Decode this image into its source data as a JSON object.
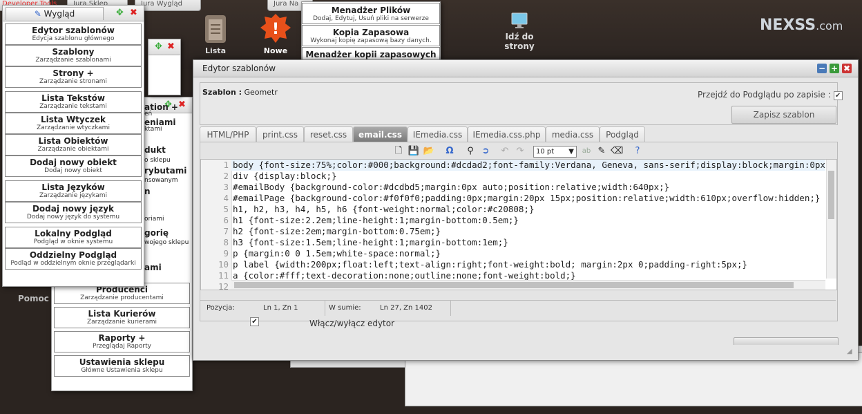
{
  "top": {
    "tabs": [
      "Developer Tools",
      "Jura Sklep",
      "Jura Wygląd",
      "Jura Na"
    ],
    "icons": [
      {
        "label": "Lista",
        "icon": "clipboard-icon"
      },
      {
        "label": "Nowe",
        "icon": "alert-icon"
      },
      {
        "label": "Idź do strony",
        "icon": "monitor-icon"
      }
    ],
    "logo": "NEXSS",
    "logo_suffix": ".com"
  },
  "files_menu": [
    {
      "title": "Menadżer Plików",
      "sub": "Dodaj, Edytuj, Usuń pliki na serwerze"
    },
    {
      "title": "Kopia Zapasowa",
      "sub": "Wykonaj kopię zapasową bazy danych."
    },
    {
      "title": "Menadżer kopii zapasowych",
      "sub": ""
    }
  ],
  "wyglad_panel": {
    "title": "Wygląd",
    "items": [
      {
        "title": "Edytor szablonów",
        "sub": "Edycja szablonu głównego"
      },
      {
        "title": "Szablony",
        "sub": "Zarządzanie szablonami"
      },
      {
        "title": "Strony +",
        "sub": "Zarządzanie stronami"
      },
      {
        "sep": true
      },
      {
        "title": "Lista Tekstów",
        "sub": "Zarządzanie tekstami"
      },
      {
        "title": "Lista Wtyczek",
        "sub": "Zarządzanie wtyczkami"
      },
      {
        "title": "Lista Obiektów",
        "sub": "Zarządzanie obiektami"
      },
      {
        "title": "Dodaj nowy obiekt",
        "sub": "Dodaj nowy obiekt"
      },
      {
        "sep": true
      },
      {
        "title": "Lista Języków",
        "sub": "Zarządzanie językami"
      },
      {
        "title": "Dodaj nowy język",
        "sub": "Dodaj nowy język do systemu"
      },
      {
        "sep": true
      },
      {
        "title": "Lokalny Podgląd",
        "sub": "Podgląd w oknie systemu"
      },
      {
        "title": "Oddzielny Podgląd",
        "sub": "Podląd w oddzielnym oknie przeglądarki"
      }
    ]
  },
  "back_panel_items": [
    {
      "title": "Producenci",
      "sub": "Zarządzanie producentami"
    },
    {
      "title": "Lista Kurierów",
      "sub": "Zarządzanie kurierami"
    },
    {
      "title": "Raporty +",
      "sub": "Przeglądaj Raporty"
    },
    {
      "title": "Ustawienia sklepu",
      "sub": "Główne Ustawienia sklepu"
    }
  ],
  "back_fragments": [
    "ation +",
    "eń",
    "eniami",
    "ktami",
    "dukt",
    "o sklepu",
    "rybutami",
    "nsowanym",
    "n",
    "oriami",
    "gorię",
    "wojego sklepu",
    "ami"
  ],
  "pomoc": "Pomoc",
  "editor": {
    "title": "Edytor szablonów",
    "template_label": "Szablon :",
    "template_value": "Geometr",
    "preview_label": "Przejdź do Podglądu po zapisie :",
    "save_button": "Zapisz szablon",
    "tabs": [
      "HTML/PHP",
      "print.css",
      "reset.css",
      "email.css",
      "IEmedia.css",
      "IEmedia.css.php",
      "media.css",
      "Podgląd"
    ],
    "active_tab": "email.css",
    "font_size": "10 pt",
    "code_lines": [
      "body {font-size:75%;color:#000;background:#dcdad2;font-family:Verdana, Geneva, sans-serif;display:block;margin:0px;}",
      "div {display:block;}",
      "#emailBody {background-color:#dcdbd5;margin:0px auto;position:relative;width:640px;}",
      "#emailPage {background-color:#f0f0f0;padding:0px;margin:20px 15px;position:relative;width:610px;overflow:hidden;}",
      "h1, h2, h3, h4, h5, h6 {font-weight:normal;color:#c20808;}",
      "h1 {font-size:2.2em;line-height:1;margin-bottom:0.5em;}",
      "h2 {font-size:2em;margin-bottom:0.75em;}",
      "h3 {font-size:1.5em;line-height:1;margin-bottom:1em;}",
      "p {margin:0 0 1.5em;white-space:normal;}",
      "p label {width:200px;float:left;text-align:right;font-weight:bold; margin:2px 0;padding-right:5px;}",
      "a {color:#fff;text-decoration:none;outline:none;font-weight:bold;}",
      "a:link, a:visited {color:black;}"
    ],
    "status_position_label": "Pozycja:",
    "status_position": "Ln 1, Zn 1",
    "status_total_label": "W sumie:",
    "status_total": "Ln 27, Zn 1402",
    "toggle_label": "Włącz/wyłącz edytor"
  },
  "colors": {
    "accent": "#e33",
    "window_bg": "#e6e6e6",
    "active_tab": "#888888"
  }
}
